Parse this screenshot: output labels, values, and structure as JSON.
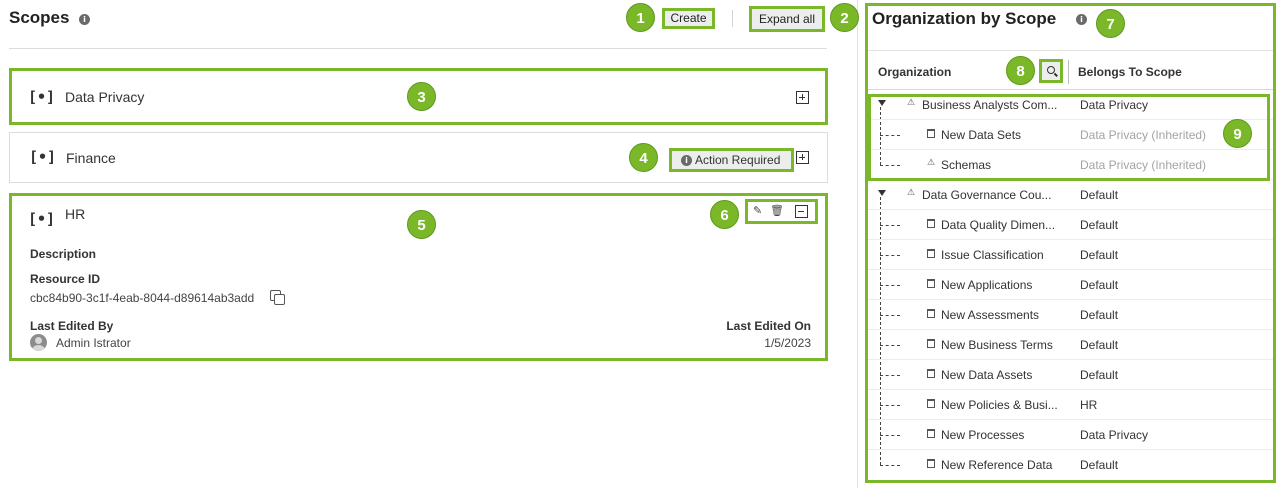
{
  "scopes": {
    "title": "Scopes",
    "create_label": "Create",
    "expand_all_label": "Expand all",
    "scope_icon": "[•]",
    "cards": [
      {
        "name": "Data Privacy"
      },
      {
        "name": "Finance",
        "action_label": "Action Required"
      },
      {
        "name": "HR",
        "description_label": "Description",
        "resource_id_label": "Resource ID",
        "resource_id": "cbc84b90-3c1f-4eab-8044-d89614ab3add",
        "last_edited_by_label": "Last Edited By",
        "last_edited_by": "Admin Istrator",
        "last_edited_on_label": "Last Edited On",
        "last_edited_on": "1/5/2023"
      }
    ]
  },
  "org": {
    "title": "Organization by Scope",
    "col_org": "Organization",
    "col_scope": "Belongs To Scope",
    "rows": [
      {
        "name": "Business Analysts Com...",
        "scope": "Data Privacy"
      },
      {
        "name": "New Data Sets",
        "scope": "Data Privacy (Inherited)"
      },
      {
        "name": "Schemas",
        "scope": "Data Privacy (Inherited)"
      },
      {
        "name": "Data Governance Cou...",
        "scope": "Default"
      },
      {
        "name": "Data Quality Dimen...",
        "scope": "Default"
      },
      {
        "name": "Issue Classification",
        "scope": "Default"
      },
      {
        "name": "New Applications",
        "scope": "Default"
      },
      {
        "name": "New Assessments",
        "scope": "Default"
      },
      {
        "name": "New Business Terms",
        "scope": "Default"
      },
      {
        "name": "New Data Assets",
        "scope": "Default"
      },
      {
        "name": "New Policies & Busi...",
        "scope": "HR"
      },
      {
        "name": "New Processes",
        "scope": "Data Privacy"
      },
      {
        "name": "New Reference Data",
        "scope": "Default"
      }
    ]
  },
  "badges": [
    "1",
    "2",
    "3",
    "4",
    "5",
    "6",
    "7",
    "8",
    "9"
  ],
  "colors": {
    "highlight": "#7ab829",
    "badge": "#7ab829",
    "inherited": "#a4a4a4"
  },
  "icons": {
    "info": "info-icon",
    "scope": "scope-bracket-icon",
    "expand": "plus-box-icon",
    "collapse": "minus-box-icon",
    "edit": "pencil-icon",
    "delete": "trash-icon",
    "copy": "copy-icon",
    "search": "search-icon",
    "expand_tree": "triangle-down-icon",
    "org_node": "community-icon",
    "domain_node": "domain-icon"
  }
}
